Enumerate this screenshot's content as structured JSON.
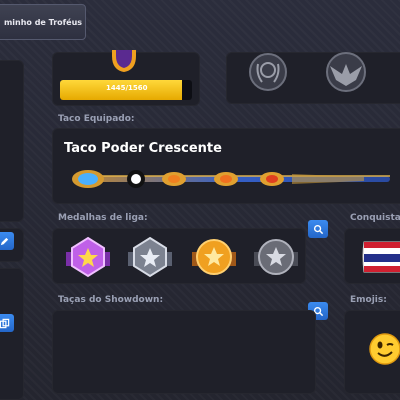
{
  "header": {
    "trophy_path_button": "minho de Troféus"
  },
  "progress": {
    "text": "1445/1560",
    "value": 1445,
    "max": 1560
  },
  "cue": {
    "section_label": "Taco Equipado:",
    "name": "Taco Poder Crescente"
  },
  "medals": {
    "section_label": "Medalhas de liga:",
    "items": [
      {
        "icon": "purple-star-medal",
        "color": "#b04fd8"
      },
      {
        "icon": "silver-star-medal",
        "color": "#b8bcc8"
      },
      {
        "icon": "gold-star-medal",
        "color": "#f0a020"
      },
      {
        "icon": "gray-star-medal",
        "color": "#9a9aa4"
      }
    ]
  },
  "achievements": {
    "section_label": "Conquista"
  },
  "showdown": {
    "section_label": "Taças do Showdown:"
  },
  "emojis": {
    "section_label": "Emojis:"
  },
  "colors": {
    "accent_blue": "#2f7be0",
    "progress_yellow": "#ffc400",
    "panel": "#1f2029"
  }
}
